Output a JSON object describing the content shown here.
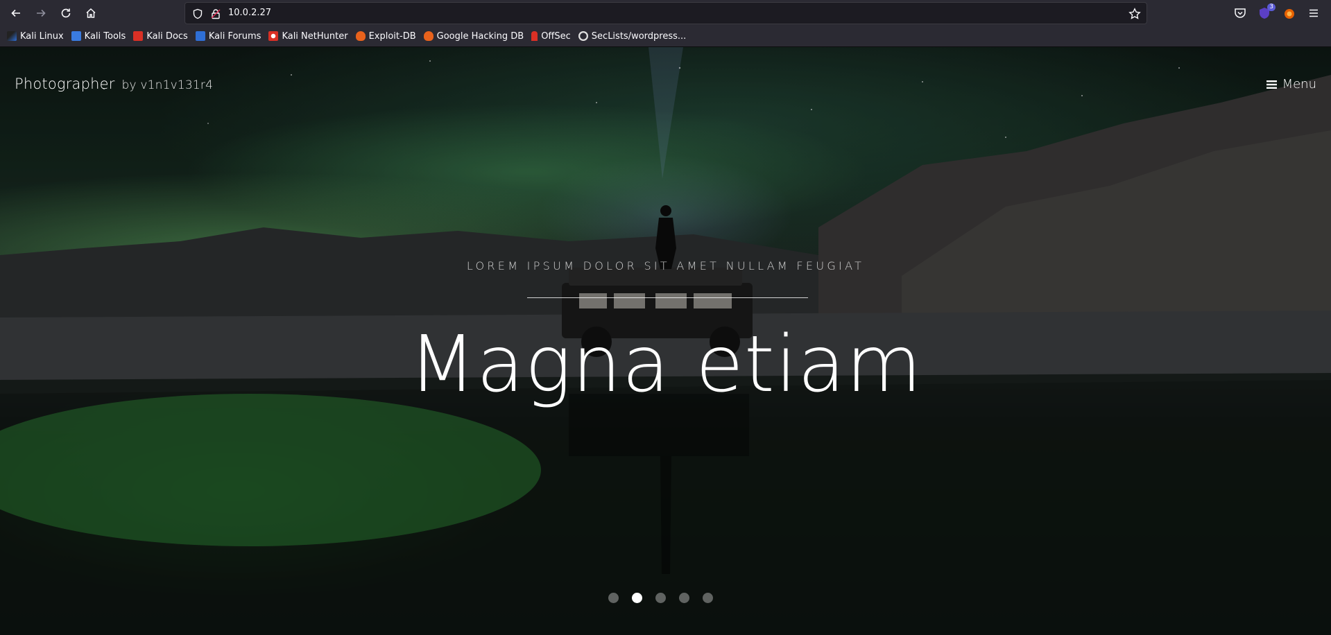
{
  "browser": {
    "url": "10.0.2.27",
    "extension_badge": "3",
    "bookmarks": [
      {
        "label": "Kali Linux",
        "color": "#2f6fd6"
      },
      {
        "label": "Kali Tools",
        "color": "#3a7be0"
      },
      {
        "label": "Kali Docs",
        "color": "#d93025"
      },
      {
        "label": "Kali Forums",
        "color": "#2f6fd6"
      },
      {
        "label": "Kali NetHunter",
        "color": "#d93025"
      },
      {
        "label": "Exploit-DB",
        "color": "#e8621c"
      },
      {
        "label": "Google Hacking DB",
        "color": "#e8621c"
      },
      {
        "label": "OffSec",
        "color": "#d93025"
      },
      {
        "label": "SecLists/wordpress...",
        "color": "#e0e0e0"
      }
    ]
  },
  "site": {
    "brand": "Photographer",
    "byline": "by v1n1v131r4",
    "menu_label": "Menu"
  },
  "hero": {
    "subtitle": "LOREM IPSUM DOLOR SIT AMET NULLAM FEUGIAT",
    "title": "Magna etiam",
    "slides": 5,
    "active_slide": 2
  },
  "colors": {
    "chrome_bg": "#2b2a33",
    "urlbar_bg": "#1c1b22",
    "text": "#fbfbfe",
    "aurora_green": "#5ec86a"
  }
}
